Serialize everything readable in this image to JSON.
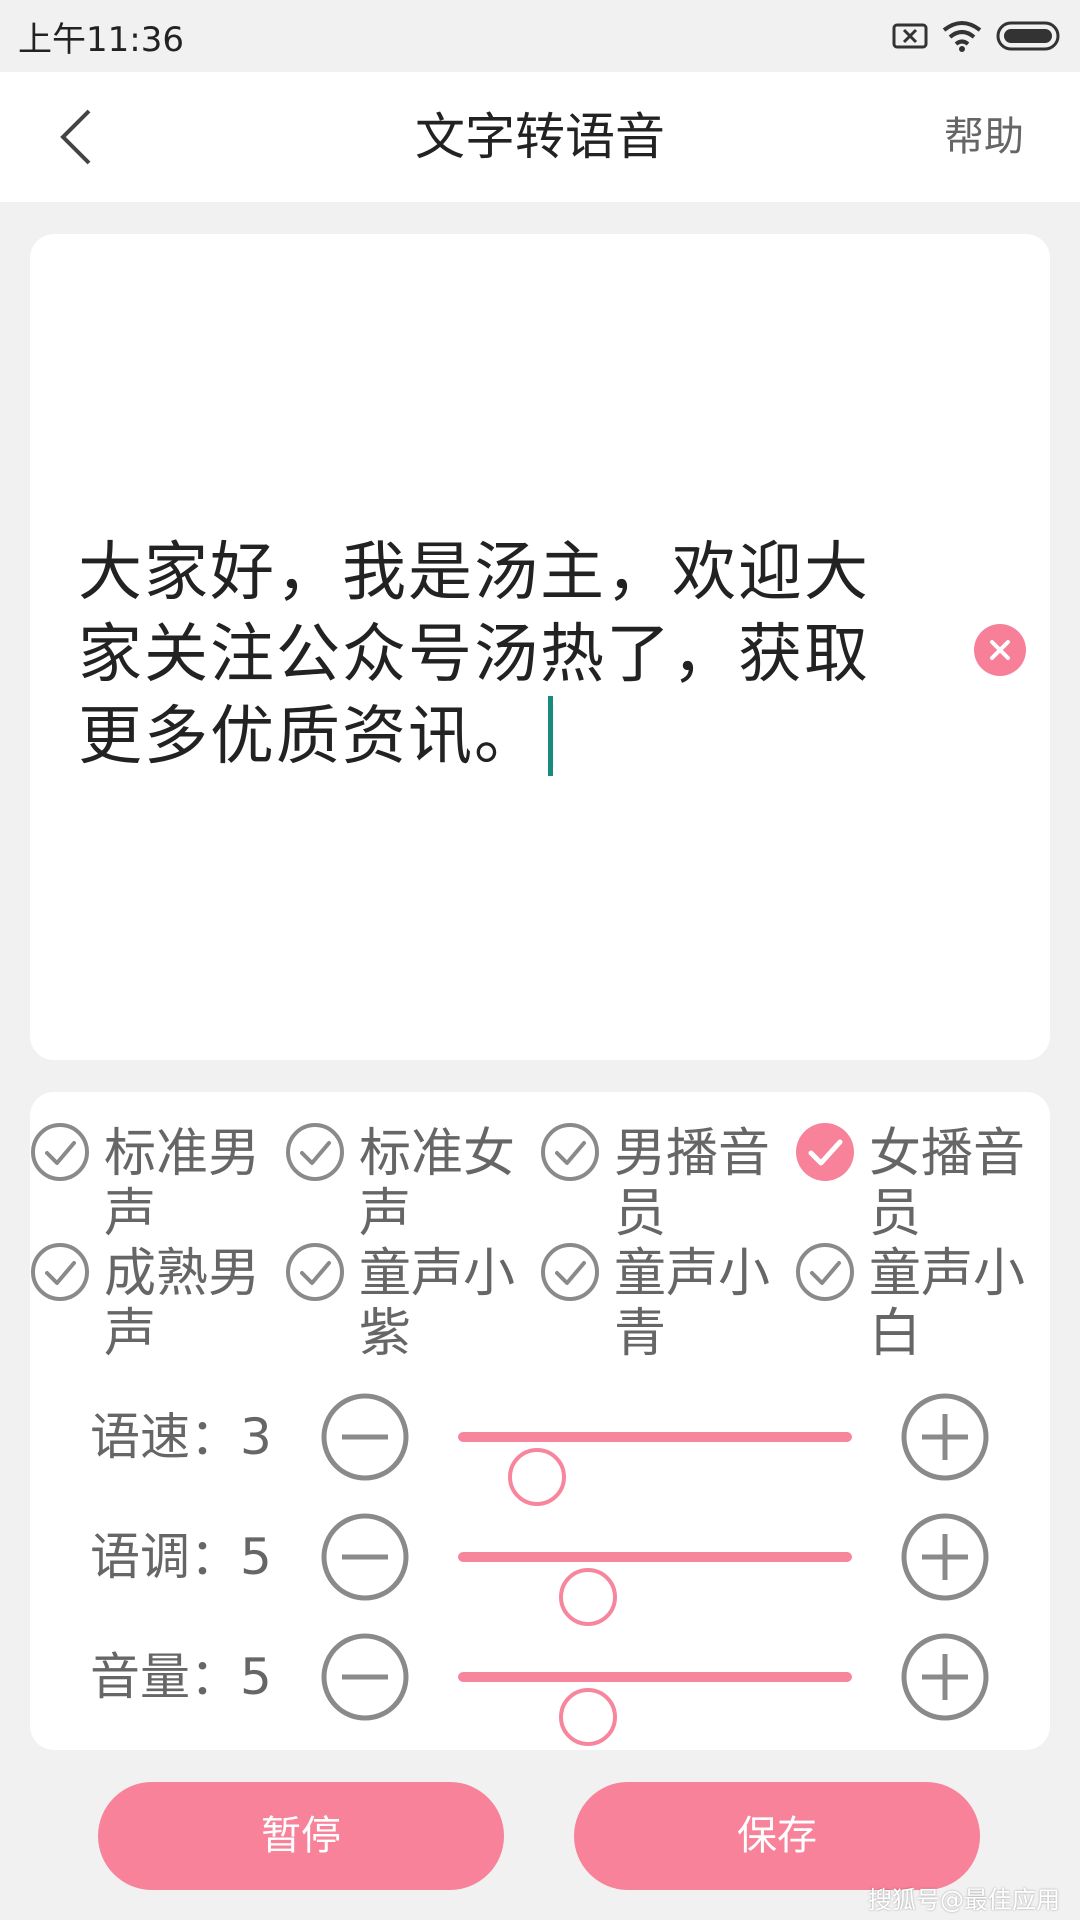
{
  "status_bar": {
    "time": "上午11:36",
    "icons": [
      "sim-off-icon",
      "wifi-icon",
      "battery-icon"
    ]
  },
  "nav": {
    "back_icon": "chevron-left-icon",
    "title": "文字转语音",
    "help_label": "帮助"
  },
  "editor": {
    "text": "大家好，我是汤主，欢迎大家关注公众号汤热了，获取更多优质资讯。",
    "clear_icon": "close-circle-icon"
  },
  "voices": [
    {
      "label": "标准男声",
      "selected": false
    },
    {
      "label": "标准女声",
      "selected": false
    },
    {
      "label": "男播音员",
      "selected": false
    },
    {
      "label": "女播音员",
      "selected": true
    },
    {
      "label": "成熟男声",
      "selected": false
    },
    {
      "label": "童声小紫",
      "selected": false
    },
    {
      "label": "童声小青",
      "selected": false
    },
    {
      "label": "童声小白",
      "selected": false
    }
  ],
  "sliders": [
    {
      "label": "语速：3",
      "level_fraction": 0.2
    },
    {
      "label": "语调：5",
      "level_fraction": 0.33
    },
    {
      "label": "音量：5",
      "level_fraction": 0.33
    }
  ],
  "actions": {
    "pause_label": "暂停",
    "save_label": "保存"
  },
  "watermark": "搜狐号@最佳应用",
  "colors": {
    "accent": "#f78299",
    "caret": "#1b8a7e",
    "icon_gray": "#8a8a8a"
  }
}
